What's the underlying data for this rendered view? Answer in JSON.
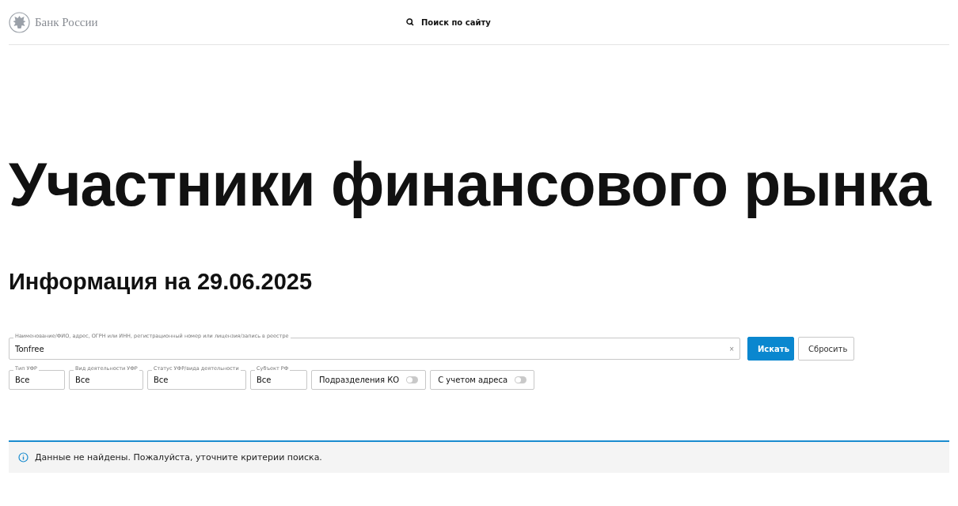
{
  "header": {
    "logo_text": "Банк России",
    "search_link": "Поиск по сайту"
  },
  "title": "Участники финансового рынка",
  "subtitle": "Информация на 29.06.2025",
  "search": {
    "label": "Наименование/ФИО, адрес, ОГРН или ИНН, регистрационный номер или лицензия/запись в реестре",
    "value": "Tonfree",
    "clear": "×"
  },
  "buttons": [
    {
      "label": "Искать",
      "kind": "primary"
    },
    {
      "label": "Сбросить",
      "kind": "secondary"
    }
  ],
  "filters": [
    {
      "kind": "select",
      "label": "Тип УФР",
      "value": "Все"
    },
    {
      "kind": "select",
      "label": "Вид деятельности УФР",
      "value": "Все"
    },
    {
      "kind": "select",
      "label": "Статус УФР/вида деятельности",
      "value": "Все"
    },
    {
      "kind": "select",
      "label": "Субъект РФ",
      "value": "Все"
    },
    {
      "kind": "toggle",
      "label": "Подразделения КО",
      "on": false
    },
    {
      "kind": "toggle",
      "label": "С учетом адреса",
      "on": false
    }
  ],
  "notice": "Данные не найдены. Пожалуйста, уточните критерии поиска."
}
